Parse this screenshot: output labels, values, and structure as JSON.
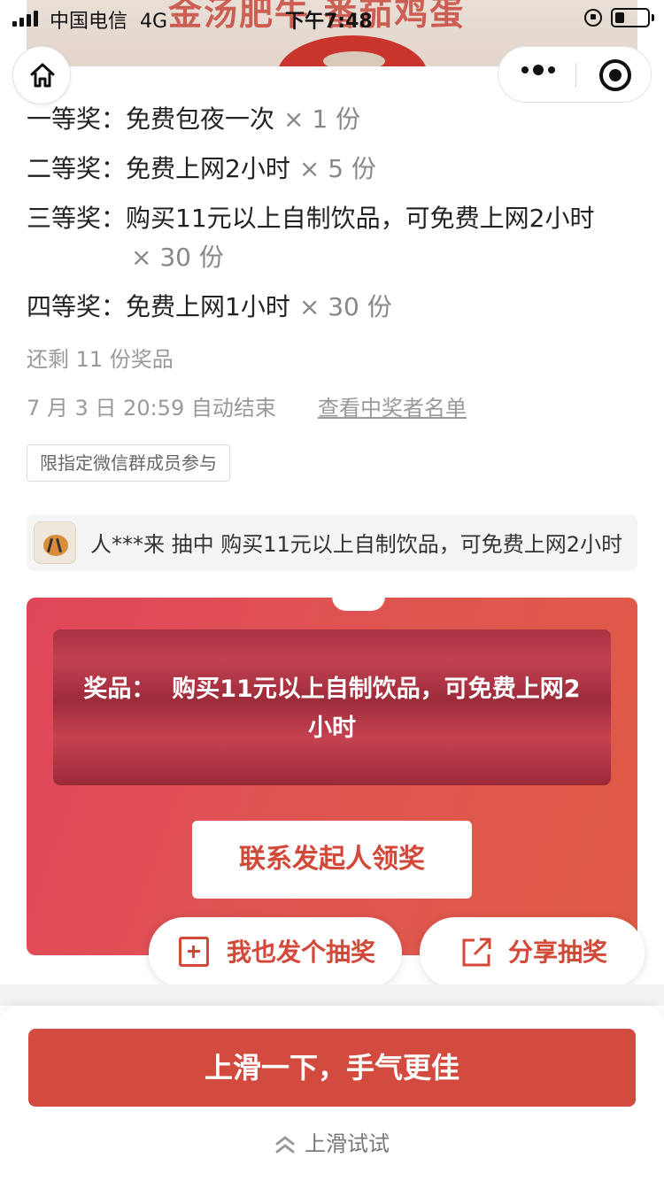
{
  "status_bar": {
    "carrier": "中国电信",
    "network": "4G",
    "time": "下午7:48"
  },
  "banner": {
    "text": "金汤肥牛 番茄鸡蛋"
  },
  "prizes": [
    {
      "level": "一等奖：",
      "name": "免费包夜一次",
      "qty": "× 1 份"
    },
    {
      "level": "二等奖：",
      "name": "免费上网2小时",
      "qty": "× 5 份"
    },
    {
      "level": "三等奖：",
      "name": "购买11元以上自制饮品，可免费上网2小时",
      "qty": "× 30 份"
    },
    {
      "level": "四等奖：",
      "name": "免费上网1小时",
      "qty": "× 30 份"
    }
  ],
  "remaining": "还剩 11 份奖品",
  "end_time": "7 月 3 日 20:59 自动结束",
  "winners_link": "查看中奖者名单",
  "restriction": "限指定微信群成员参与",
  "ticker": {
    "text": "人***来 抽中 购买11元以上自制饮品，可免费上网2小时"
  },
  "prize_card": {
    "label": "奖品：",
    "prize": "购买11元以上自制饮品，可免费上网2小时",
    "contact_button": "联系发起人领奖"
  },
  "actions": {
    "create_lottery": "我也发个抽奖",
    "share_lottery": "分享抽奖"
  },
  "bottom": {
    "main_button": "上滑一下，手气更佳",
    "hint": "上滑试试"
  },
  "colors": {
    "accent": "#d24b3e",
    "card_start": "#e0465a",
    "card_end": "#df5a44"
  }
}
